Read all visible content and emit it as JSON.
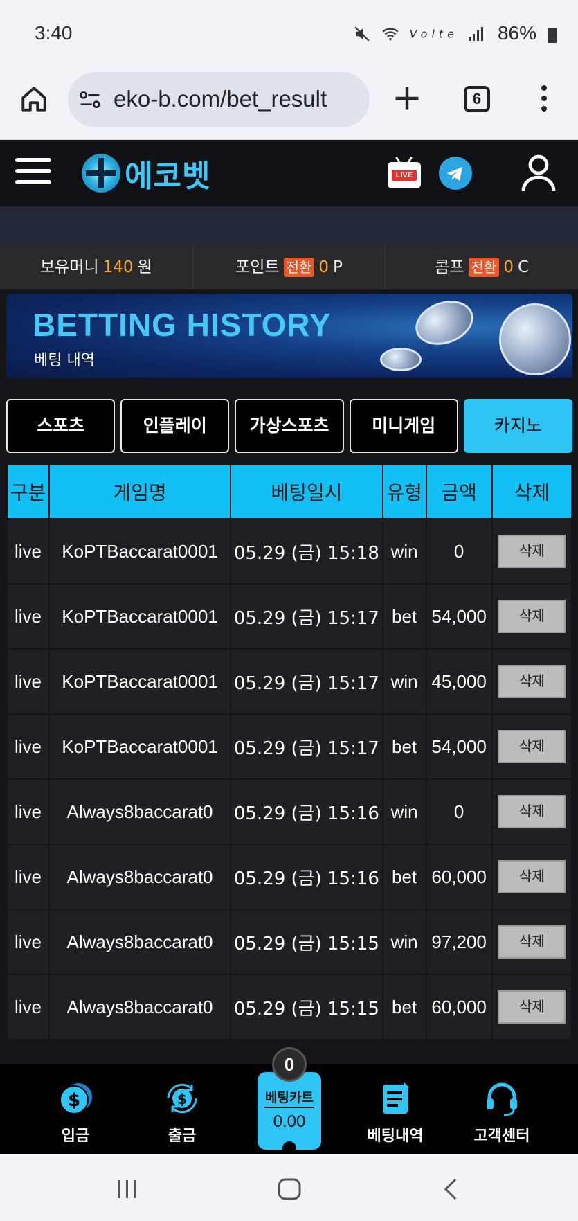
{
  "status_bar": {
    "time": "3:40",
    "battery": "86%"
  },
  "browser": {
    "url": "eko-b.com/bet_result",
    "tab_count": "6"
  },
  "site": {
    "logo_text": "에코벳",
    "live_badge": "LIVE"
  },
  "balance": {
    "money_label": "보유머니",
    "money_value": "140",
    "money_unit": "원",
    "point_label": "포인트",
    "point_convert": "전환",
    "point_value": "0",
    "point_unit": "P",
    "comp_label": "콤프",
    "comp_convert": "전환",
    "comp_value": "0",
    "comp_unit": "C"
  },
  "banner": {
    "title": "BETTING HISTORY",
    "subtitle": "베팅 내역"
  },
  "tabs": [
    {
      "label": "스포츠"
    },
    {
      "label": "인플레이"
    },
    {
      "label": "가상스포츠"
    },
    {
      "label": "미니게임"
    },
    {
      "label": "카지노",
      "active": true
    }
  ],
  "table": {
    "headers": [
      "구분",
      "게임명",
      "베팅일시",
      "유형",
      "금액",
      "삭제"
    ],
    "rows": [
      {
        "category": "live",
        "game": "KoPTBaccarat0001",
        "datetime": "05.29 (금) 15:18",
        "type": "win",
        "amount": "0",
        "delete": "삭제"
      },
      {
        "category": "live",
        "game": "KoPTBaccarat0001",
        "datetime": "05.29 (금) 15:17",
        "type": "bet",
        "amount": "54,000",
        "delete": "삭제"
      },
      {
        "category": "live",
        "game": "KoPTBaccarat0001",
        "datetime": "05.29 (금) 15:17",
        "type": "win",
        "amount": "45,000",
        "delete": "삭제"
      },
      {
        "category": "live",
        "game": "KoPTBaccarat0001",
        "datetime": "05.29 (금) 15:17",
        "type": "bet",
        "amount": "54,000",
        "delete": "삭제"
      },
      {
        "category": "live",
        "game": "Always8baccarat0",
        "datetime": "05.29 (금) 15:16",
        "type": "win",
        "amount": "0",
        "delete": "삭제"
      },
      {
        "category": "live",
        "game": "Always8baccarat0",
        "datetime": "05.29 (금) 15:16",
        "type": "bet",
        "amount": "60,000",
        "delete": "삭제"
      },
      {
        "category": "live",
        "game": "Always8baccarat0",
        "datetime": "05.29 (금) 15:15",
        "type": "win",
        "amount": "97,200",
        "delete": "삭제"
      },
      {
        "category": "live",
        "game": "Always8baccarat0",
        "datetime": "05.29 (금) 15:15",
        "type": "bet",
        "amount": "60,000",
        "delete": "삭제"
      }
    ]
  },
  "bottom_nav": {
    "deposit": "입금",
    "withdraw": "출금",
    "cart_title": "베팅카트",
    "cart_count": "0",
    "cart_value": "0.00",
    "history": "베팅내역",
    "support": "고객센터"
  },
  "colors": {
    "accent": "#2ec4f4",
    "highlight": "#f5a623",
    "convert": "#e8572a",
    "background": "#141518"
  }
}
